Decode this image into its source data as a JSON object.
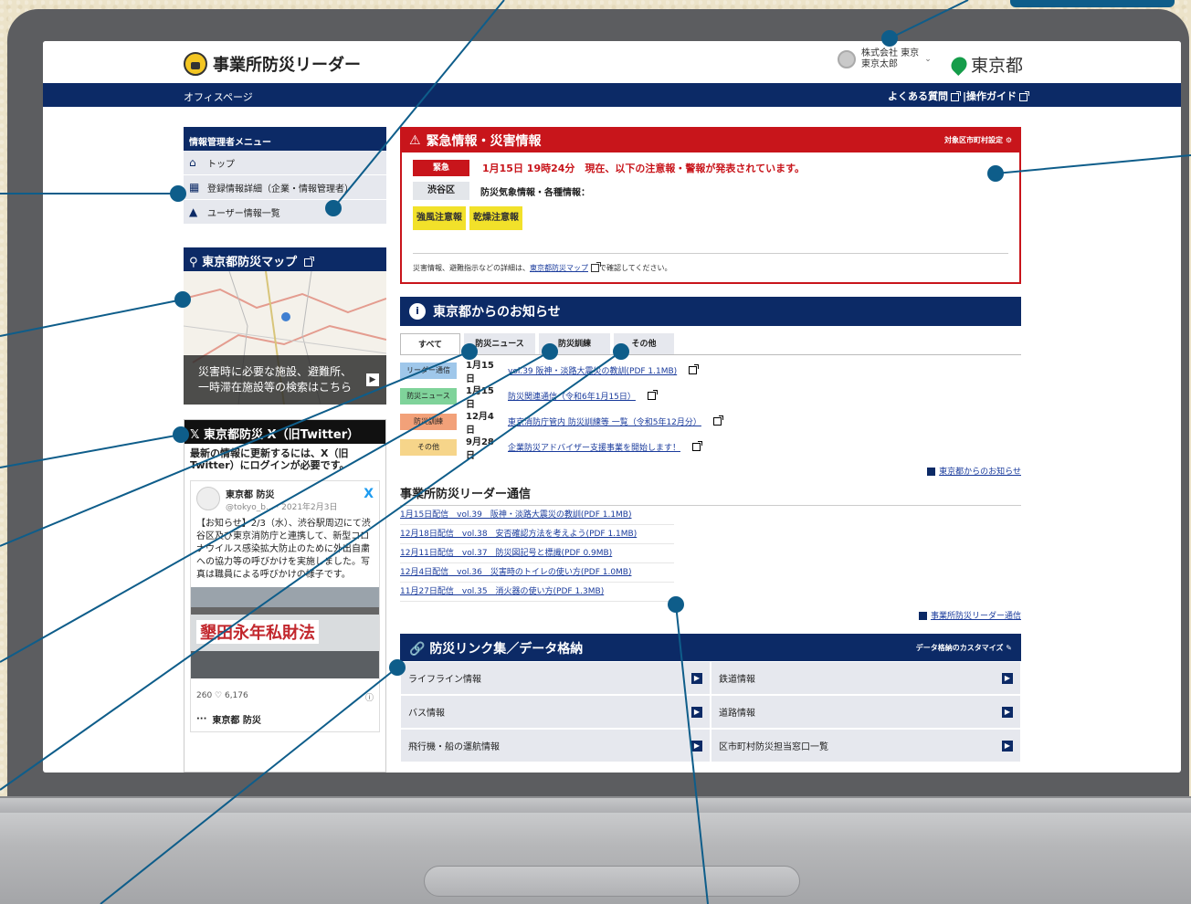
{
  "header": {
    "logo_text": "事業所防災リーダー",
    "user_company": "株式会社 東京",
    "user_name": "東京太郎",
    "tokyo_label": "東京都"
  },
  "navbar": {
    "left": "オフィスページ",
    "faq": "よくある質問",
    "guide": "|操作ガイド"
  },
  "sidebar": {
    "title": "情報管理者メニュー",
    "items": [
      {
        "icon": "home-icon",
        "label": "トップ"
      },
      {
        "icon": "building-icon",
        "label": "登録情報詳細（企業・情報管理者）"
      },
      {
        "icon": "users-icon",
        "label": "ユーザー情報一覧"
      }
    ]
  },
  "map": {
    "title": "東京都防災マップ",
    "caption_line1": "災害時に必要な施設、避難所、",
    "caption_line2": "一時滞在施設等の検索はこちら"
  },
  "twitter": {
    "title": "東京都防災 X（旧Twitter）",
    "intro": "最新の情報に更新するには、X（旧Twitter）にログインが必要です。",
    "account": "東京都 防災",
    "handle": "@tokyo_b... · 2021年2月3日",
    "text": "【お知らせ】2/3（水）、渋谷駅周辺にて渋谷区及び東京消防庁と連携して、新型コロナウイルス感染拡大防止のために外出自粛への協力等の呼びかけを実施しました。写真は職員による呼びかけの様子です。",
    "photo_banner": "墾田永年私財法",
    "stats": "260 ♡ 6,176",
    "next_account": "東京都 防災"
  },
  "emergency": {
    "title": "緊急情報・災害情報",
    "settings": "対象区市町村設定",
    "badge": "緊急",
    "headline": "1月15日 19時24分　現在、以下の注意報・警報が発表されています。",
    "area": "渋谷区",
    "area_info": "防災気象情報・各種情報：",
    "warnings": [
      "強風注意報",
      "乾燥注意報"
    ],
    "note_prefix": "災害情報、避難指示などの詳細は、",
    "note_link": "東京都防災マップ",
    "note_suffix": "で確認してください。"
  },
  "news": {
    "title": "東京都からのお知らせ",
    "tabs": [
      "すべて",
      "防災ニュース",
      "防災訓練",
      "その他"
    ],
    "rows": [
      {
        "category": "リーダー通信",
        "date": "1月15日",
        "text": "vol.39 阪神・淡路大震災の教訓(PDF 1.1MB)",
        "color": "#9fc7ea"
      },
      {
        "category": "防災ニュース",
        "date": "1月15日",
        "text": "防災関連通信（令和6年1月15日）",
        "color": "#7fd39a"
      },
      {
        "category": "防災訓練",
        "date": "12月4日",
        "text": "東京消防庁管内 防災訓練等 一覧（令和5年12月分）",
        "color": "#f2a179"
      },
      {
        "category": "その他",
        "date": "9月28日",
        "text": "企業防災アドバイザー支援事業を開始します！",
        "color": "#f6d58a"
      }
    ],
    "more": "東京都からのお知らせ"
  },
  "leader": {
    "title": "事業所防災リーダー通信",
    "rows": [
      "1月15日配信　vol.39　阪神・淡路大震災の教訓(PDF 1.1MB)",
      "12月18日配信　vol.38　安否確認方法を考えよう(PDF 1.1MB)",
      "12月11日配信　vol.37　防災図記号と標識(PDF 0.9MB)",
      "12月4日配信　vol.36　災害時のトイレの使い方(PDF 1.0MB)",
      "11月27日配信　vol.35　消火器の使い方(PDF 1.3MB)"
    ],
    "more": "事業所防災リーダー通信"
  },
  "links": {
    "title": "防災リンク集／データ格納",
    "customize": "データ格納のカスタマイズ",
    "items": [
      "ライフライン情報",
      "鉄道情報",
      "バス情報",
      "道路情報",
      "飛行機・船の運航情報",
      "区市町村防災担当窓口一覧"
    ]
  },
  "colors": {
    "navy": "#0c2a66",
    "emergency_red": "#c8151b",
    "warning_yellow": "#f2e12a",
    "callout_blue": "#0e5d8a"
  }
}
